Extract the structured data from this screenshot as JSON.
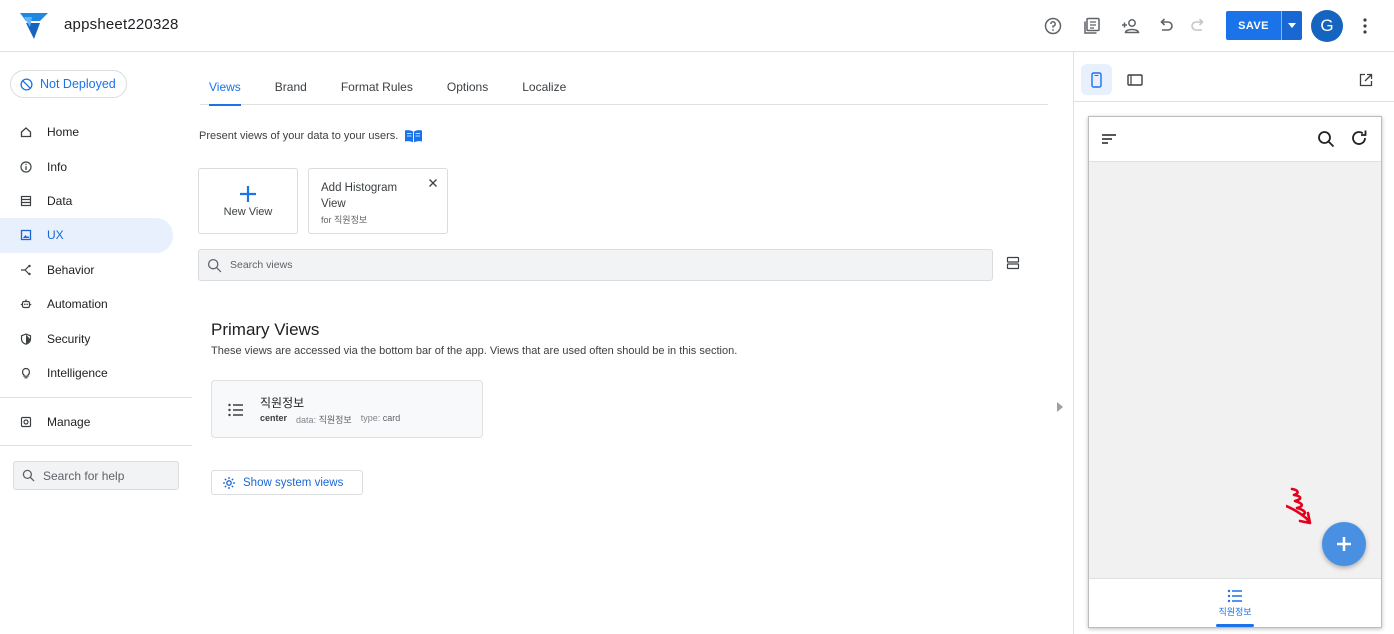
{
  "app": {
    "title": "appsheet220328",
    "save_label": "SAVE",
    "avatar_initial": "G",
    "accent": "#1a73e8"
  },
  "sidebar": {
    "deploy_status": "Not Deployed",
    "items": [
      {
        "label": "Home",
        "icon": "home-icon"
      },
      {
        "label": "Info",
        "icon": "info-icon"
      },
      {
        "label": "Data",
        "icon": "data-icon"
      },
      {
        "label": "UX",
        "icon": "ux-icon",
        "active": true
      },
      {
        "label": "Behavior",
        "icon": "behavior-icon"
      },
      {
        "label": "Automation",
        "icon": "automation-icon"
      },
      {
        "label": "Security",
        "icon": "shield-icon"
      },
      {
        "label": "Intelligence",
        "icon": "lightbulb-icon"
      }
    ],
    "manage_label": "Manage",
    "help_placeholder": "Search for help"
  },
  "main": {
    "tabs": [
      "Views",
      "Brand",
      "Format Rules",
      "Options",
      "Localize"
    ],
    "active_tab": "Views",
    "intro": "Present views of your data to your users.",
    "new_view_label": "New View",
    "suggestion": {
      "title": "Add Histogram View",
      "subtitle": "for 직원정보"
    },
    "search_placeholder": "Search views",
    "primary_title": "Primary Views",
    "primary_desc": "These views are accessed via the bottom bar of the app. Views that are used often should be in this section.",
    "view": {
      "name": "직원정보",
      "position": "center",
      "data_key": "data:",
      "data_value": "직원정보",
      "type_key": "type:",
      "type_value": "card"
    },
    "system_views_label": "Show system views"
  },
  "preview": {
    "bottom_tab_label": "직원정보"
  }
}
